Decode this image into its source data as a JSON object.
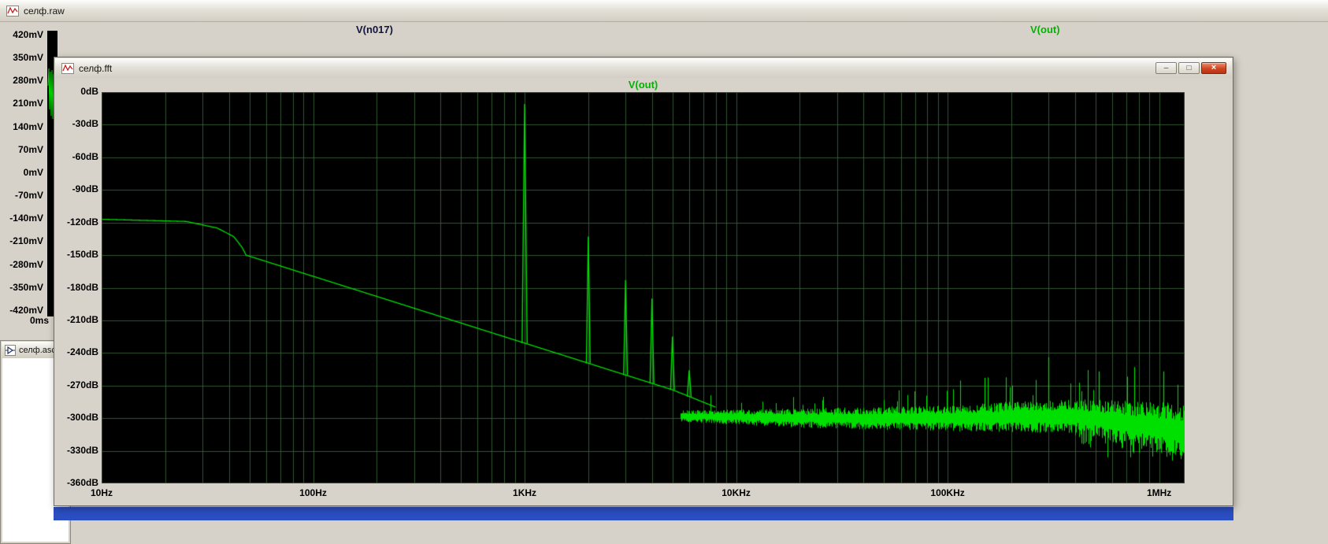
{
  "raw_window": {
    "title": "селф.raw",
    "legend_left": "V(n017)",
    "legend_right": "V(out)",
    "y_axis_labels": [
      "420mV",
      "350mV",
      "280mV",
      "210mV",
      "140mV",
      "70mV",
      "0mV",
      "-70mV",
      "-140mV",
      "-210mV",
      "-280mV",
      "-350mV",
      "-420mV"
    ],
    "x_axis_first_label": "0ms"
  },
  "asc_window": {
    "title": "селф.asc"
  },
  "fft_window": {
    "title": "селф.fft",
    "buttons": [
      {
        "name": "minimize",
        "glyph": "–"
      },
      {
        "name": "maximize",
        "glyph": "□"
      },
      {
        "name": "close",
        "glyph": "×"
      }
    ]
  },
  "colors": {
    "trace": "#00e000",
    "grid": "#355535",
    "plot_bg": "#000000",
    "fft_legend": "#00b400",
    "raw_legend_left": "#14143c",
    "raw_legend_right": "#00b400",
    "blue_bar": "#2b4fc2"
  },
  "chart_data": {
    "type": "line",
    "title": "V(out)",
    "series_name": "V(out)",
    "x_scale": "log",
    "grid": true,
    "legend_position": "top-center",
    "x_range_hz": [
      10,
      1320000
    ],
    "y_range_db": [
      -360,
      0
    ],
    "x_ticks": [
      {
        "f": 10,
        "label": "10Hz"
      },
      {
        "f": 100,
        "label": "100Hz"
      },
      {
        "f": 1000,
        "label": "1KHz"
      },
      {
        "f": 10000,
        "label": "10KHz"
      },
      {
        "f": 100000,
        "label": "100KHz"
      },
      {
        "f": 1000000,
        "label": "1MHz"
      }
    ],
    "y_ticks": [
      {
        "db": 0,
        "label": "0dB"
      },
      {
        "db": -30,
        "label": "-30dB"
      },
      {
        "db": -60,
        "label": "-60dB"
      },
      {
        "db": -90,
        "label": "-90dB"
      },
      {
        "db": -120,
        "label": "-120dB"
      },
      {
        "db": -150,
        "label": "-150dB"
      },
      {
        "db": -180,
        "label": "-180dB"
      },
      {
        "db": -210,
        "label": "-210dB"
      },
      {
        "db": -240,
        "label": "-240dB"
      },
      {
        "db": -270,
        "label": "-270dB"
      },
      {
        "db": -300,
        "label": "-300dB"
      },
      {
        "db": -330,
        "label": "-330dB"
      },
      {
        "db": -360,
        "label": "-360dB"
      }
    ],
    "baseline_points_hz_db": [
      [
        10,
        -117
      ],
      [
        25,
        -119
      ],
      [
        35,
        -125
      ],
      [
        42,
        -133
      ],
      [
        46,
        -143
      ],
      [
        48,
        -150
      ],
      [
        5000,
        -274
      ],
      [
        8000,
        -290
      ]
    ],
    "harmonic_peaks_hz_db": [
      [
        1000,
        -11
      ],
      [
        2000,
        -133
      ],
      [
        3000,
        -173
      ],
      [
        4000,
        -190
      ],
      [
        5000,
        -225
      ],
      [
        6000,
        -256
      ]
    ],
    "noise_regions": [
      {
        "f0": 5200,
        "f1": 20000,
        "mean0": -298,
        "mean1": -300,
        "spread0": 5,
        "spread1": 9,
        "spike_p": 0.05,
        "spike_amp": 22
      },
      {
        "f0": 20000,
        "f1": 100000,
        "mean0": -300,
        "mean1": -300,
        "spread0": 9,
        "spread1": 12,
        "spike_p": 0.04,
        "spike_amp": 28
      },
      {
        "f0": 100000,
        "f1": 400000,
        "mean0": -300,
        "mean1": -298,
        "spread0": 12,
        "spread1": 16,
        "spike_p": 0.06,
        "spike_amp": 38
      },
      {
        "f0": 400000,
        "f1": 1320000,
        "mean0": -298,
        "mean1": -312,
        "spread0": 16,
        "spread1": 26,
        "spike_p": 0.07,
        "spike_amp": 45,
        "down_extra": 18
      }
    ],
    "extra_spikes_hz_db": [
      [
        150000,
        -263
      ],
      [
        300000,
        -244
      ],
      [
        520000,
        -257
      ],
      [
        760000,
        -253
      ],
      [
        1050000,
        -257
      ]
    ]
  }
}
